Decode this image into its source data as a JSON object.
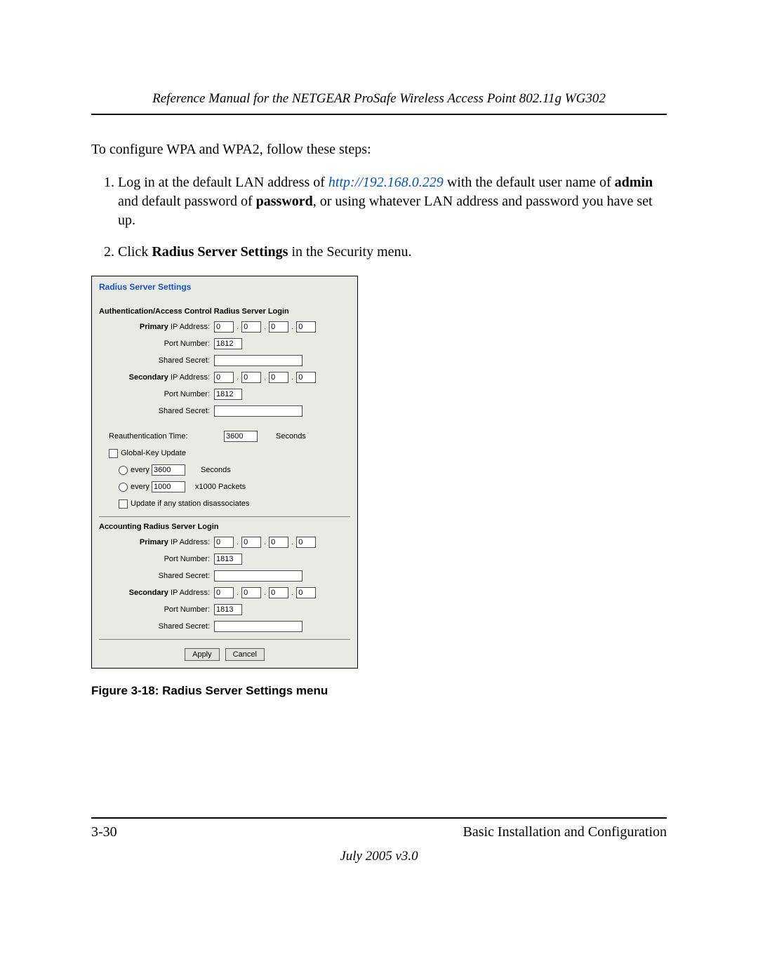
{
  "header": {
    "title": "Reference Manual for the NETGEAR ProSafe Wireless Access Point 802.11g WG302"
  },
  "intro": "To configure WPA and WPA2, follow these steps:",
  "steps": {
    "s1_pre": "Log in at the default LAN address of ",
    "s1_link": "http://192.168.0.229",
    "s1_mid": " with the default user name of ",
    "s1_admin": "admin",
    "s1_mid2": " and default password of ",
    "s1_pwd": "password",
    "s1_post": ", or using whatever LAN address and password you have set up.",
    "s2_pre": "Click ",
    "s2_bold": "Radius Server Settings",
    "s2_post": " in the Security menu."
  },
  "shot": {
    "title": "Radius Server Settings",
    "section1": "Authentication/Access Control Radius Server Login",
    "section2": "Accounting Radius Server Login",
    "labels": {
      "primary_ip": "Primary",
      "primary_ip_suffix": " IP Address:",
      "port": "Port Number:",
      "secret": "Shared Secret:",
      "secondary_ip": "Secondary",
      "secondary_ip_suffix": " IP Address:",
      "reauth": "Reauthentication Time:",
      "globalkey": "Global-Key Update",
      "every": "every",
      "seconds": "Seconds",
      "packets": "x1000 Packets",
      "disassoc": "Update if any station disassociates"
    },
    "values": {
      "ip_octet": "0",
      "auth_port": "1812",
      "acct_port": "1813",
      "reauth_time": "3600",
      "gk_seconds": "3600",
      "gk_packets": "1000",
      "secret": ""
    },
    "buttons": {
      "apply": "Apply",
      "cancel": "Cancel"
    }
  },
  "caption": "Figure 3-18:  Radius Server Settings menu",
  "footer": {
    "page": "3-30",
    "section": "Basic Installation and Configuration",
    "date": "July 2005 v3.0"
  }
}
